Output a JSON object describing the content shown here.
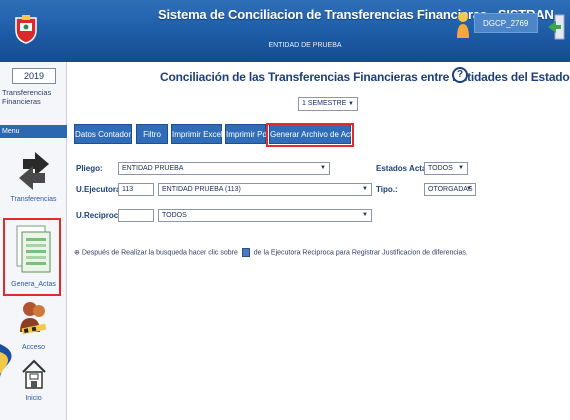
{
  "header": {
    "title": "Sistema de Conciliacion de Transferencias Financieras - SISTRAN",
    "subtitle": "ENTIDAD DE PRUEBA",
    "user": "DGCP_2769"
  },
  "sidebar": {
    "year": "2019",
    "title_line1": "Transferencias",
    "title_line2": "Financieras",
    "menu_label": "Menu",
    "items": [
      {
        "label": "Transferencias",
        "icon": "transfer-arrows-icon"
      },
      {
        "label": "Genera_Actas",
        "icon": "spreadsheet-icon"
      },
      {
        "label": "Acceso",
        "icon": "users-access-icon"
      },
      {
        "label": "Inicio",
        "icon": "home-icon"
      }
    ]
  },
  "main": {
    "title": "Conciliación de las Transferencias Financieras entre Entidades del Estado",
    "semestre": "1 SEMESTRE",
    "tabs": [
      {
        "label": "Datos Contador"
      },
      {
        "label": "Filtro"
      },
      {
        "label": "Imprimir Excel"
      },
      {
        "label": "Imprimir Pdf"
      },
      {
        "label": "Generar Archivo de Actas"
      }
    ],
    "form": {
      "pliego_label": "Pliego:",
      "pliego_value": "ENTIDAD PRUEBA",
      "ejecutora_label": "U.Ejecutora:",
      "ejecutora_code": "113",
      "ejecutora_value": "ENTIDAD PRUEBA (113)",
      "reciproca_label": "U.Reciproca:",
      "reciproca_code": "",
      "reciproca_value": "TODOS",
      "estados_label": "Estados Acta.:",
      "estados_value": "TODOS",
      "tipo_label": "Tipo.:",
      "tipo_value": "OTORGADAS"
    },
    "note_before": "Después de Realizar la busqueda hacer clic sobre",
    "note_after": "de la Ejecutora Reciproca para Registrar Justificacion de diferencias."
  },
  "colors": {
    "header_blue": "#1d5ba6",
    "tab_blue": "#2f6db8",
    "highlight_red": "#e32b2b"
  }
}
